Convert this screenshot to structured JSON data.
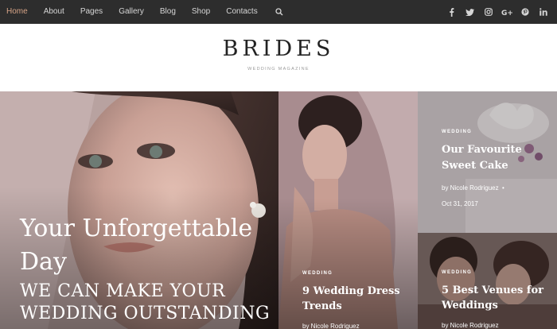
{
  "nav": {
    "items": [
      "Home",
      "About",
      "Pages",
      "Gallery",
      "Blog",
      "Shop",
      "Contacts"
    ],
    "active_index": 0,
    "social": [
      "f",
      "t",
      "ig",
      "G+",
      "p",
      "in"
    ]
  },
  "header": {
    "logo": "BRIDES",
    "tagline": "WEDDING MAGAZINE"
  },
  "hero": {
    "title": "Your Unforgettable Day",
    "subtitle": "WE CAN MAKE YOUR WEDDING OUTSTANDING"
  },
  "cards": {
    "dress": {
      "category": "WEDDING",
      "title": "9 Wedding Dress Trends",
      "author": "by Nicole Rodriguez"
    },
    "cake": {
      "category": "WEDDING",
      "title": "Our Favourite Sweet Cake",
      "author": "by Nicole Rodriguez",
      "date": "Oct 31, 2017"
    },
    "venue": {
      "category": "WEDDING",
      "title": "5 Best Venues for Weddings",
      "author": "by Nicole Rodriguez"
    }
  },
  "colors": {
    "nav_bg": "#2d2d2d",
    "accent": "#d7a487"
  }
}
